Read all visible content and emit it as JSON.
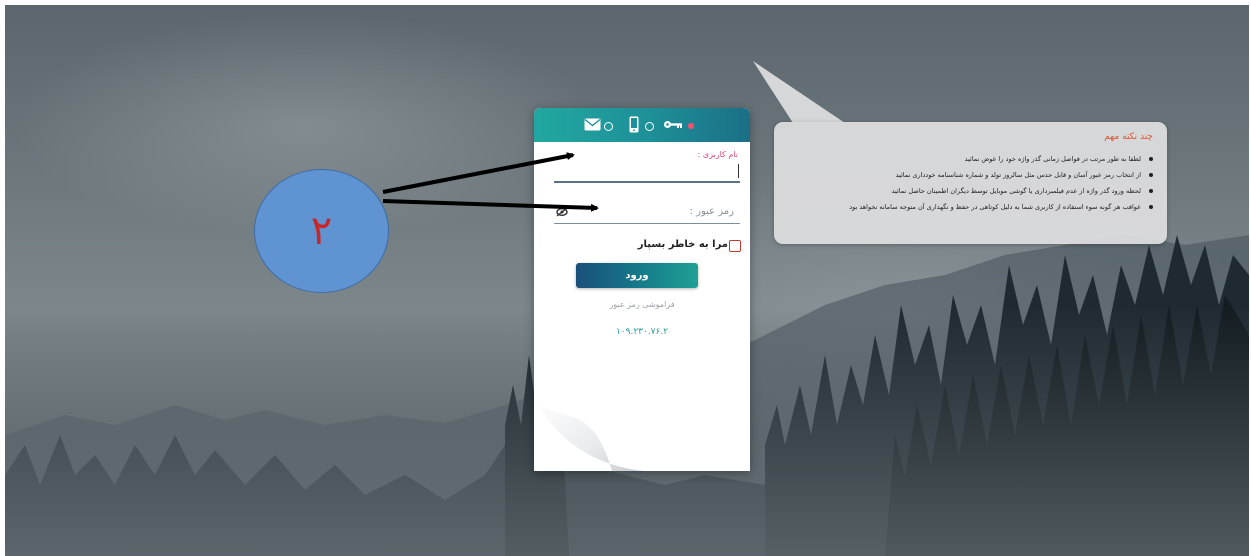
{
  "login": {
    "username_label": "نام کاربری :",
    "password_placeholder": "رمز عبور :",
    "remember_label": "مرا به خاطر بسپار",
    "login_button": "ورود",
    "forgot_link": "فراموشی رمز عبور",
    "version": "۱۰۹.۲۳۰.۷۶.۲",
    "tabs": [
      {
        "icon": "envelope-icon"
      },
      {
        "icon": "mobile-icon"
      },
      {
        "icon": "key-icon",
        "active": true
      }
    ]
  },
  "tips": {
    "title": "چند نکته مهم",
    "items": [
      "لطفا به طور مرتب در فواصل زمانی گذر واژه خود را عوض نمائید",
      "از انتخاب رمز عبور آسان و قابل حدس مثل سالروز تولد و شماره شناسنامه خودداری نمائید",
      "لحظه ورود گذر واژه از عدم فیلمبرداری یا گوشی موبایل توسط دیگران اطمینان حاصل نمائید",
      "عواقب هر گونه سوء استفاده از کاربری شما به دلیل کوتاهی در حفظ و نگهداری آن متوجه سامانه نخواهد بود"
    ]
  },
  "annotation": {
    "badge": "۲"
  },
  "colors": {
    "accent_teal": "#22a7a0",
    "badge_blue": "#5f93d1",
    "badge_number": "#c62828",
    "tips_title": "#e0542e"
  }
}
